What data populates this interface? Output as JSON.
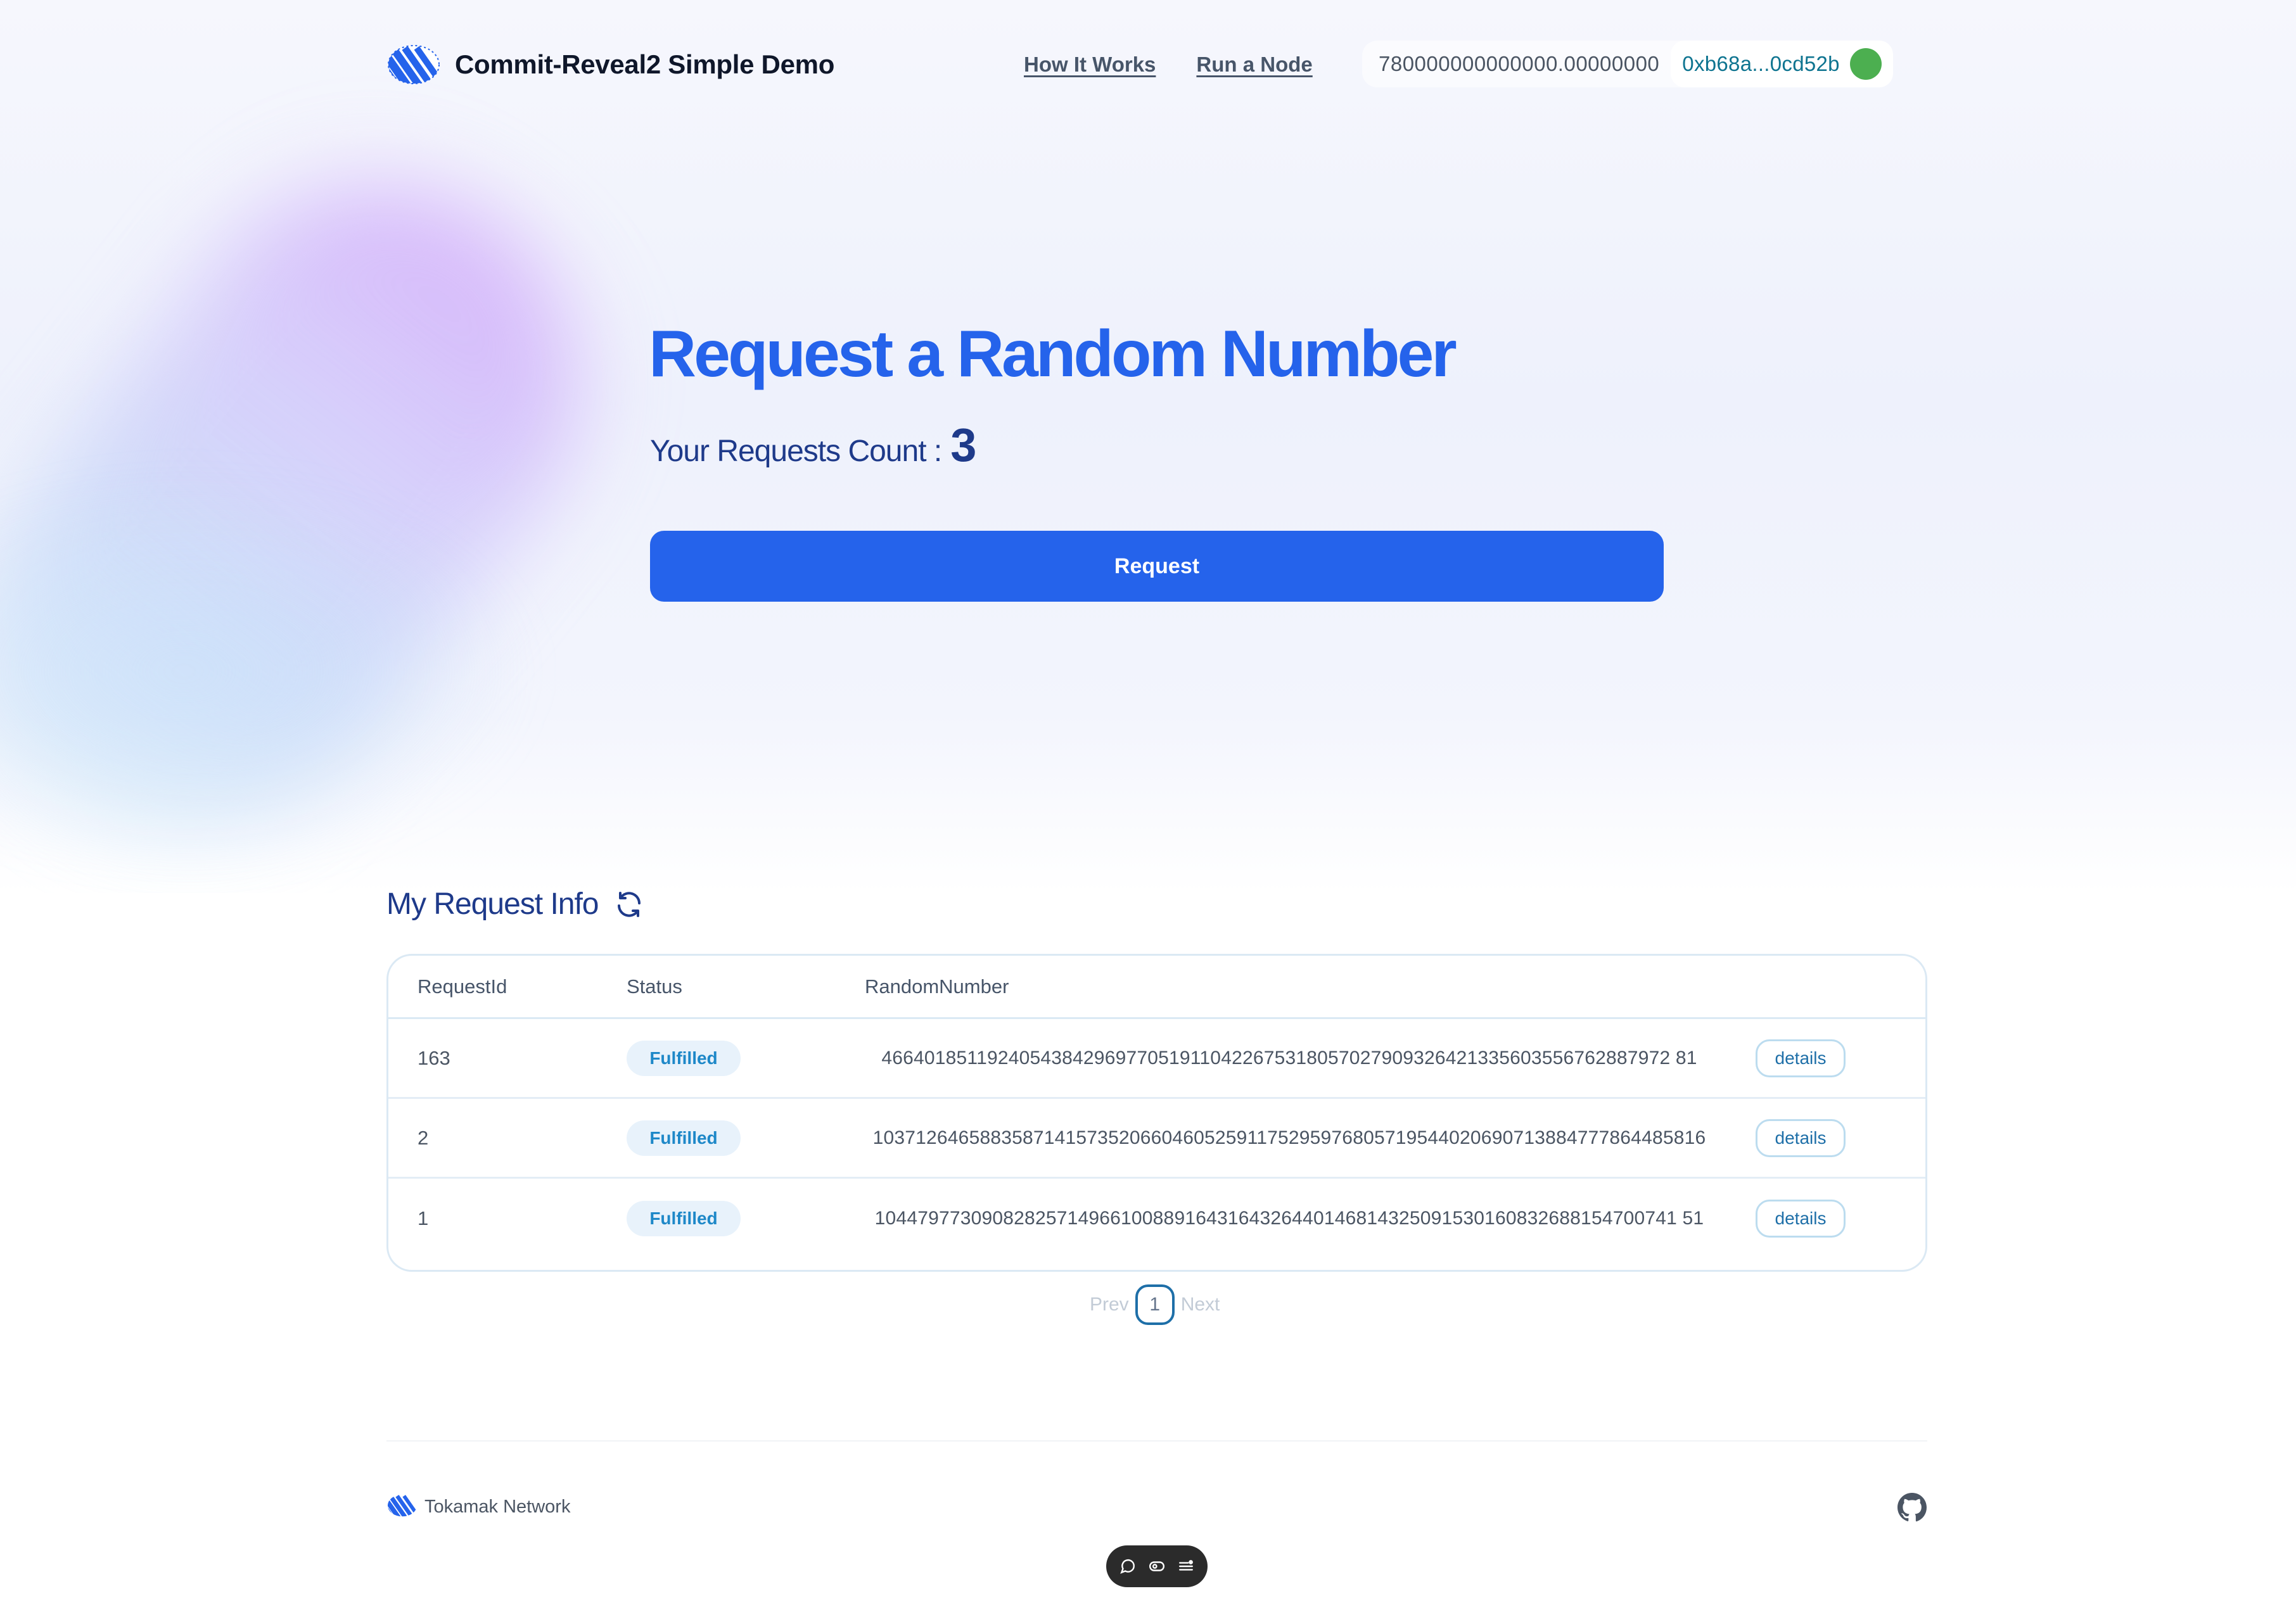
{
  "header": {
    "title": "Commit-Reveal2 Simple Demo",
    "nav": [
      {
        "label": "How It Works"
      },
      {
        "label": "Run a Node"
      }
    ],
    "wallet": {
      "balance": "780000000000000.00000000",
      "address": "0xb68a...0cd52b",
      "status_color": "#4caf50"
    }
  },
  "hero": {
    "title": "Request a Random Number",
    "count_label": "Your Requests Count :",
    "count_value": "3",
    "request_button": "Request"
  },
  "request_info": {
    "title": "My Request Info",
    "columns": [
      "RequestId",
      "Status",
      "RandomNumber",
      ""
    ],
    "rows": [
      {
        "id": "163",
        "status": "Fulfilled",
        "random": "46640185119240543842969770519110422675318057027909326421335603556762887972 81",
        "action": "details"
      },
      {
        "id": "2",
        "status": "Fulfilled",
        "random": "103712646588358714157352066046052591175295976805719544020690713884777864485816",
        "action": "details"
      },
      {
        "id": "1",
        "status": "Fulfilled",
        "random": "104479773090828257149661008891643164326440146814325091530160832688154700741 51",
        "action": "details"
      }
    ],
    "pagination": {
      "prev": "Prev",
      "page": "1",
      "next": "Next"
    }
  },
  "footer": {
    "brand": "Tokamak Network"
  },
  "colors": {
    "accent": "#2563eb",
    "title_dark": "#1e3a8a",
    "badge_text": "#1e88c8"
  }
}
